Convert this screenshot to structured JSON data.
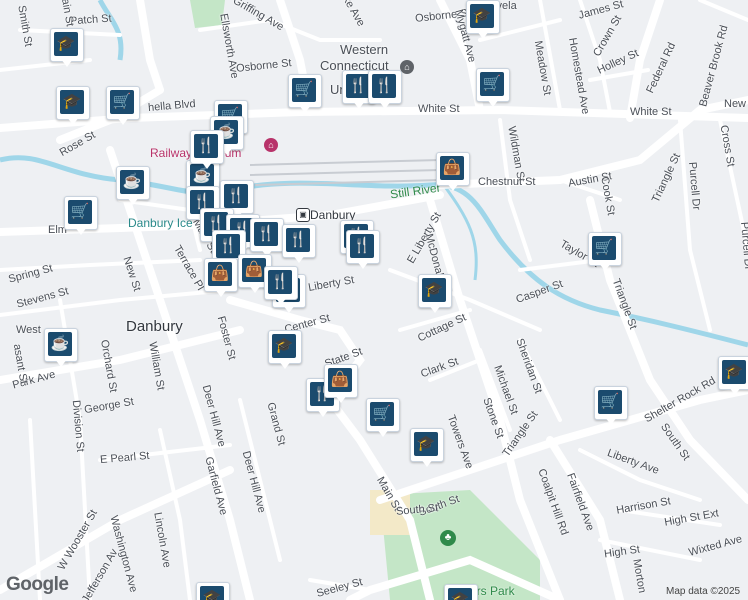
{
  "map": {
    "colors": {
      "background": "#eef0f3",
      "road": "#ffffff",
      "road_edge": "#d9dde3",
      "water": "#9fd6e9",
      "park": "#c4e6c7",
      "marker_fill": "#1b4b6e"
    },
    "place_labels": [
      {
        "id": "danbury",
        "text": "Danbury"
      },
      {
        "id": "western",
        "text": "Western"
      },
      {
        "id": "connecticut",
        "text": "Connecticut"
      }
    ],
    "poi_labels": [
      {
        "id": "railway",
        "text": "Railway Museum",
        "style": "pink"
      },
      {
        "id": "danburyice",
        "text": "Danbury Ice",
        "style": "teal"
      },
      {
        "id": "danburystation",
        "text": "Danbury",
        "style": "dark"
      },
      {
        "id": "stillriver",
        "text": "Still River",
        "style": "green"
      },
      {
        "id": "rogerspark",
        "text": "ers Park",
        "style": "green"
      },
      {
        "id": "unfrag",
        "text": "Ur",
        "style": "dark"
      }
    ],
    "street_labels": [
      {
        "id": "smith",
        "text": "Smith St"
      },
      {
        "id": "patch",
        "text": "Patch St"
      },
      {
        "id": "main-n",
        "text": "Main St"
      },
      {
        "id": "ellsworth",
        "text": "Ellsworth Ave"
      },
      {
        "id": "griffing",
        "text": "Griffing Ave"
      },
      {
        "id": "osborne",
        "text": "Osborne St"
      },
      {
        "id": "osborne2",
        "text": "Osborne St"
      },
      {
        "id": "mygatt",
        "text": "Mygatt Ave"
      },
      {
        "id": "lakeave",
        "text": "Lake Ave"
      },
      {
        "id": "cleveland",
        "text": "Clevela"
      },
      {
        "id": "james",
        "text": "James St"
      },
      {
        "id": "crown",
        "text": "Crown St"
      },
      {
        "id": "homestead",
        "text": "Homestead Ave"
      },
      {
        "id": "holley",
        "text": "Holley St"
      },
      {
        "id": "meadow",
        "text": "Meadow St"
      },
      {
        "id": "federal",
        "text": "Federal Rd"
      },
      {
        "id": "beaverbrook",
        "text": "Beaver Brook Rd"
      },
      {
        "id": "new",
        "text": "New"
      },
      {
        "id": "rose",
        "text": "Rose St"
      },
      {
        "id": "wellsblvd",
        "text": "hella Blvd"
      },
      {
        "id": "whitest",
        "text": "White St"
      },
      {
        "id": "whitest2",
        "text": "White St"
      },
      {
        "id": "wildman",
        "text": "Wildman St"
      },
      {
        "id": "cross",
        "text": "Cross St"
      },
      {
        "id": "chestnut",
        "text": "Chestnut St"
      },
      {
        "id": "austin",
        "text": "Austin St"
      },
      {
        "id": "cook",
        "text": "Cook St"
      },
      {
        "id": "triangle",
        "text": "Triangle St"
      },
      {
        "id": "purcell",
        "text": "Purcell Dr"
      },
      {
        "id": "purcell2",
        "text": "Purcell Dr"
      },
      {
        "id": "elm",
        "text": "Elm"
      },
      {
        "id": "eliberty",
        "text": "E Liberty St"
      },
      {
        "id": "liberty",
        "text": "Liberty St"
      },
      {
        "id": "mcdonald",
        "text": "McDonald"
      },
      {
        "id": "taylor",
        "text": "Taylor St"
      },
      {
        "id": "spring",
        "text": "Spring St"
      },
      {
        "id": "stevens",
        "text": "Stevens St"
      },
      {
        "id": "newst",
        "text": "New St"
      },
      {
        "id": "terrace",
        "text": "Terrace Pl"
      },
      {
        "id": "west",
        "text": "West"
      },
      {
        "id": "casper",
        "text": "Casper St"
      },
      {
        "id": "triangle2",
        "text": "Triangle St"
      },
      {
        "id": "center",
        "text": "Center St"
      },
      {
        "id": "cottage",
        "text": "Cottage St"
      },
      {
        "id": "foster",
        "text": "Foster St"
      },
      {
        "id": "orchard",
        "text": "Orchard St"
      },
      {
        "id": "william",
        "text": "William St"
      },
      {
        "id": "state",
        "text": "State St"
      },
      {
        "id": "sheridan",
        "text": "Sheridan St"
      },
      {
        "id": "clark",
        "text": "Clark St"
      },
      {
        "id": "michael",
        "text": "Michael St"
      },
      {
        "id": "parkave",
        "text": "Park Ave"
      },
      {
        "id": "georgest",
        "text": "George St"
      },
      {
        "id": "division",
        "text": "Division St"
      },
      {
        "id": "deerhill",
        "text": "Deer Hill Ave"
      },
      {
        "id": "deerhill2",
        "text": "Deer Hill Ave"
      },
      {
        "id": "stone",
        "text": "Stone St"
      },
      {
        "id": "towers",
        "text": "Towers Ave"
      },
      {
        "id": "shelter",
        "text": "Shelter Rock Rd"
      },
      {
        "id": "southst",
        "text": "South St"
      },
      {
        "id": "southst2",
        "text": "South St"
      },
      {
        "id": "grand",
        "text": "Grand St"
      },
      {
        "id": "epearl",
        "text": "E Pearl St"
      },
      {
        "id": "garfield",
        "text": "Garfield Ave"
      },
      {
        "id": "libertyave",
        "text": "Liberty Ave"
      },
      {
        "id": "triangle3",
        "text": "Triangle St"
      },
      {
        "id": "coalpit",
        "text": "Coalpit Hill Rd"
      },
      {
        "id": "fairfield",
        "text": "Fairfield Ave"
      },
      {
        "id": "harrison",
        "text": "Harrison St"
      },
      {
        "id": "highext",
        "text": "High St Ext"
      },
      {
        "id": "mainst",
        "text": "Main St"
      },
      {
        "id": "southst3",
        "text": "South St"
      },
      {
        "id": "wwooster",
        "text": "W Wooster St"
      },
      {
        "id": "washington",
        "text": "Washington Ave"
      },
      {
        "id": "lincoln",
        "text": "Lincoln Ave"
      },
      {
        "id": "highst",
        "text": "High St"
      },
      {
        "id": "wixted",
        "text": "Wixted Ave"
      },
      {
        "id": "jefferson",
        "text": "Jefferson Av"
      },
      {
        "id": "morton",
        "text": "Morton"
      },
      {
        "id": "seeley",
        "text": "Seeley St"
      },
      {
        "id": "pleasant",
        "text": "asant St"
      },
      {
        "id": "main-n2",
        "text": "Main St"
      }
    ],
    "markers": [
      {
        "id": "m1",
        "icon": "school",
        "glyph": "🎓"
      },
      {
        "id": "m2",
        "icon": "school",
        "glyph": "🎓"
      },
      {
        "id": "m3",
        "icon": "cart",
        "glyph": "🛒"
      },
      {
        "id": "m4",
        "icon": "cart",
        "glyph": "🛒"
      },
      {
        "id": "m5",
        "icon": "cart",
        "glyph": "🛒"
      },
      {
        "id": "m6",
        "icon": "restaurant",
        "glyph": "🍴"
      },
      {
        "id": "m7",
        "icon": "restaurant",
        "glyph": "🍴"
      },
      {
        "id": "m8",
        "icon": "cart",
        "glyph": "🛒"
      },
      {
        "id": "m9",
        "icon": "school",
        "glyph": "🎓"
      },
      {
        "id": "m10",
        "icon": "cafe",
        "glyph": "☕"
      },
      {
        "id": "m11",
        "icon": "cafe",
        "glyph": "☕"
      },
      {
        "id": "m12",
        "icon": "cafe",
        "glyph": "☕"
      },
      {
        "id": "m13",
        "icon": "cart",
        "glyph": "🛒"
      },
      {
        "id": "m14",
        "icon": "restaurant",
        "glyph": "🍴"
      },
      {
        "id": "m15",
        "icon": "restaurant",
        "glyph": "🍴"
      },
      {
        "id": "m16",
        "icon": "shopping-bag",
        "glyph": "👜"
      },
      {
        "id": "m17",
        "icon": "restaurant",
        "glyph": "🍴"
      },
      {
        "id": "m18",
        "icon": "restaurant",
        "glyph": "🍴"
      },
      {
        "id": "m19",
        "icon": "restaurant",
        "glyph": "🍴"
      },
      {
        "id": "m20",
        "icon": "restaurant",
        "glyph": "🍴"
      },
      {
        "id": "m21",
        "icon": "restaurant",
        "glyph": "🍴"
      },
      {
        "id": "m22",
        "icon": "restaurant",
        "glyph": "🍴"
      },
      {
        "id": "m23",
        "icon": "restaurant",
        "glyph": "🍴"
      },
      {
        "id": "m24",
        "icon": "shopping-bag",
        "glyph": "👜"
      },
      {
        "id": "m25",
        "icon": "shopping-bag",
        "glyph": "👜"
      },
      {
        "id": "m26",
        "icon": "shopping-bag",
        "glyph": "👜"
      },
      {
        "id": "m27",
        "icon": "cart",
        "glyph": "🛒"
      },
      {
        "id": "m28",
        "icon": "school",
        "glyph": "🎓"
      },
      {
        "id": "m29",
        "icon": "school",
        "glyph": "🎓"
      },
      {
        "id": "m30",
        "icon": "cafe",
        "glyph": "☕"
      },
      {
        "id": "m31",
        "icon": "restaurant",
        "glyph": "🍴"
      },
      {
        "id": "m32",
        "icon": "shopping-bag",
        "glyph": "👜"
      },
      {
        "id": "m33",
        "icon": "cart",
        "glyph": "🛒"
      },
      {
        "id": "m34",
        "icon": "school",
        "glyph": "🎓"
      },
      {
        "id": "m35",
        "icon": "cart",
        "glyph": "🛒"
      },
      {
        "id": "m36",
        "icon": "school",
        "glyph": "🎓"
      },
      {
        "id": "m37",
        "icon": "school",
        "glyph": "🎓"
      },
      {
        "id": "m38",
        "icon": "school",
        "glyph": "🎓"
      },
      {
        "id": "m39",
        "icon": "restaurant",
        "glyph": "🍴"
      },
      {
        "id": "m40",
        "icon": "restaurant",
        "glyph": "🍴"
      }
    ],
    "google_logo": "Google",
    "attribution": "Map data ©2025"
  }
}
